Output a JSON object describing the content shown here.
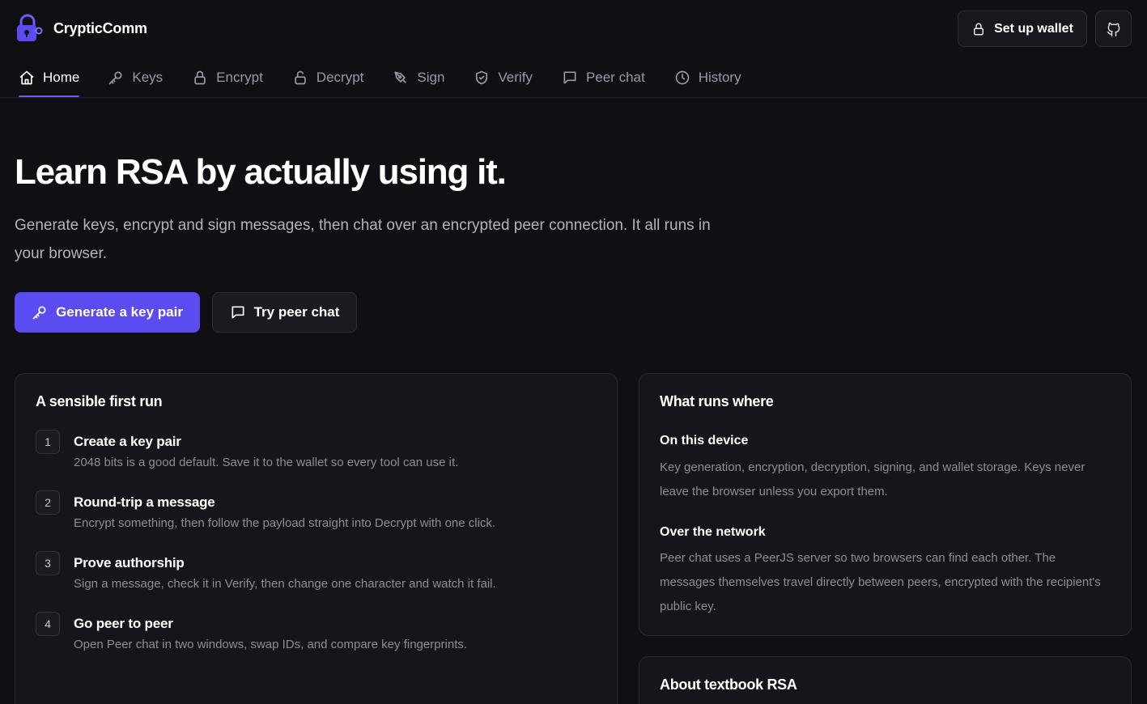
{
  "brand": {
    "name": "CrypticComm",
    "logo_icon": "lock-icon"
  },
  "header_actions": {
    "wallet_label": "Set up wallet",
    "wallet_icon": "lock-icon",
    "github_icon": "github-icon"
  },
  "nav": {
    "items": [
      {
        "label": "Home",
        "icon": "home-icon",
        "active": true
      },
      {
        "label": "Keys",
        "icon": "key-icon"
      },
      {
        "label": "Encrypt",
        "icon": "lock-icon"
      },
      {
        "label": "Decrypt",
        "icon": "unlock-icon"
      },
      {
        "label": "Sign",
        "icon": "pen-icon"
      },
      {
        "label": "Verify",
        "icon": "shield-icon"
      },
      {
        "label": "Peer chat",
        "icon": "chat-icon"
      },
      {
        "label": "History",
        "icon": "clock-icon"
      }
    ]
  },
  "hero": {
    "title": "Learn RSA by actually using it.",
    "subtitle": "Generate keys, encrypt and sign messages, then chat over an encrypted peer connection. It all runs in your browser.",
    "primary_label": "Generate a key pair",
    "secondary_label": "Try peer chat"
  },
  "first_run": {
    "title": "A sensible first run",
    "steps": [
      {
        "num": "1",
        "title": "Create a key pair",
        "desc": "2048 bits is a good default. Save it to the wallet so every tool can use it."
      },
      {
        "num": "2",
        "title": "Round-trip a message",
        "desc": "Encrypt something, then follow the payload straight into Decrypt with one click."
      },
      {
        "num": "3",
        "title": "Prove authorship",
        "desc": "Sign a message, check it in Verify, then change one character and watch it fail."
      },
      {
        "num": "4",
        "title": "Go peer to peer",
        "desc": "Open Peer chat in two windows, swap IDs, and compare key fingerprints."
      }
    ]
  },
  "where": {
    "title": "What runs where",
    "device_title": "On this device",
    "device_body": "Key generation, encryption, decryption, signing, and wallet storage. Keys never leave the browser unless you export them.",
    "network_title": "Over the network",
    "network_body": "Peer chat uses a PeerJS server so two browsers can find each other. The messages themselves travel directly between peers, encrypted with the recipient's public key."
  },
  "about": {
    "title": "About textbook RSA"
  },
  "colors": {
    "accent": "#5a4cf0",
    "background": "#0f0f14",
    "card": "#15151b"
  }
}
